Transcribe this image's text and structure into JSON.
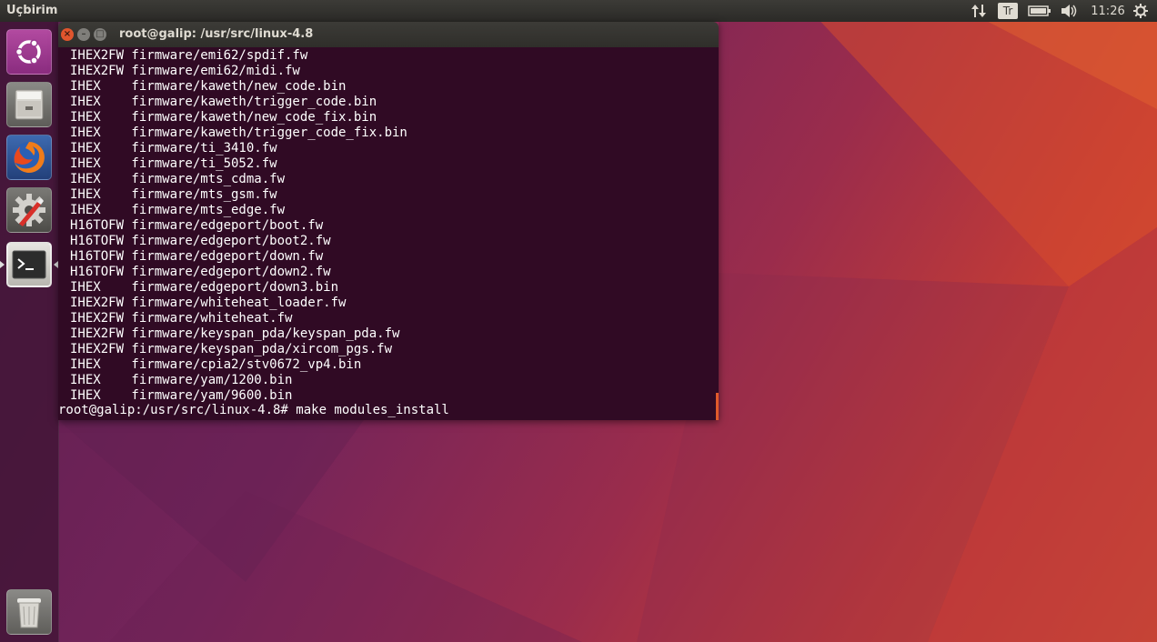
{
  "panel": {
    "title": "Uçbirim",
    "keyboard_layout": "Tr",
    "clock": "11:26"
  },
  "launcher": {
    "items": [
      {
        "name": "Ubuntu Dash",
        "icon": "ubuntu-logo-icon"
      },
      {
        "name": "Files",
        "icon": "file-cabinet-icon"
      },
      {
        "name": "Firefox",
        "icon": "firefox-icon"
      },
      {
        "name": "System Settings",
        "icon": "settings-icon"
      },
      {
        "name": "Terminal",
        "icon": "terminal-icon"
      },
      {
        "name": "Trash",
        "icon": "trash-icon"
      }
    ]
  },
  "terminal": {
    "title": "root@galip: /usr/src/linux-4.8",
    "lines": [
      "IHEX2FW firmware/emi62/spdif.fw",
      "IHEX2FW firmware/emi62/midi.fw",
      "IHEX    firmware/kaweth/new_code.bin",
      "IHEX    firmware/kaweth/trigger_code.bin",
      "IHEX    firmware/kaweth/new_code_fix.bin",
      "IHEX    firmware/kaweth/trigger_code_fix.bin",
      "IHEX    firmware/ti_3410.fw",
      "IHEX    firmware/ti_5052.fw",
      "IHEX    firmware/mts_cdma.fw",
      "IHEX    firmware/mts_gsm.fw",
      "IHEX    firmware/mts_edge.fw",
      "H16TOFW firmware/edgeport/boot.fw",
      "H16TOFW firmware/edgeport/boot2.fw",
      "H16TOFW firmware/edgeport/down.fw",
      "H16TOFW firmware/edgeport/down2.fw",
      "IHEX    firmware/edgeport/down3.bin",
      "IHEX2FW firmware/whiteheat_loader.fw",
      "IHEX2FW firmware/whiteheat.fw",
      "IHEX2FW firmware/keyspan_pda/keyspan_pda.fw",
      "IHEX2FW firmware/keyspan_pda/xircom_pgs.fw",
      "IHEX    firmware/cpia2/stv0672_vp4.bin",
      "IHEX    firmware/yam/1200.bin",
      "IHEX    firmware/yam/9600.bin"
    ],
    "prompt": "root@galip:/usr/src/linux-4.8# make modules_install"
  },
  "colors": {
    "terminal_bg": "#300a24",
    "close_button": "#e0552d",
    "accent": "#e05a2b"
  }
}
